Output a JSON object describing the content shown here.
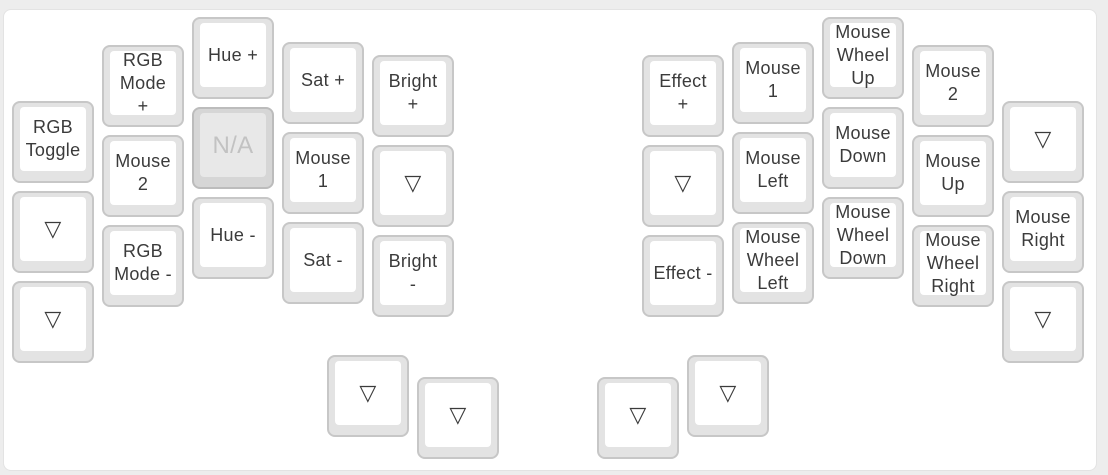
{
  "keyboard": {
    "left": [
      {
        "label": "RGB\nToggle"
      },
      {
        "label": "▽"
      },
      {
        "label": "▽"
      },
      {
        "label": "RGB\nMode\n+"
      },
      {
        "label": "Mouse\n2"
      },
      {
        "label": "RGB\nMode -"
      },
      {
        "label": "Hue +"
      },
      {
        "label": "N/A",
        "disabled": true
      },
      {
        "label": "Hue -"
      },
      {
        "label": "Sat +"
      },
      {
        "label": "Mouse\n1"
      },
      {
        "label": "Sat -"
      },
      {
        "label": "Bright\n+"
      },
      {
        "label": "▽"
      },
      {
        "label": "Bright\n-"
      },
      {
        "label": "▽"
      },
      {
        "label": "▽"
      }
    ],
    "right": [
      {
        "label": "Effect\n+"
      },
      {
        "label": "▽"
      },
      {
        "label": "Effect -"
      },
      {
        "label": "Mouse\n1"
      },
      {
        "label": "Mouse\nLeft"
      },
      {
        "label": "Mouse\nWheel\nLeft"
      },
      {
        "label": "Mouse\nWheel\nUp"
      },
      {
        "label": "Mouse\nDown"
      },
      {
        "label": "Mouse\nWheel\nDown"
      },
      {
        "label": "Mouse\n2"
      },
      {
        "label": "Mouse\nUp"
      },
      {
        "label": "Mouse\nWheel\nRight"
      },
      {
        "label": "▽"
      },
      {
        "label": "Mouse\nRight"
      },
      {
        "label": "▽"
      },
      {
        "label": "▽"
      },
      {
        "label": "▽"
      }
    ]
  }
}
